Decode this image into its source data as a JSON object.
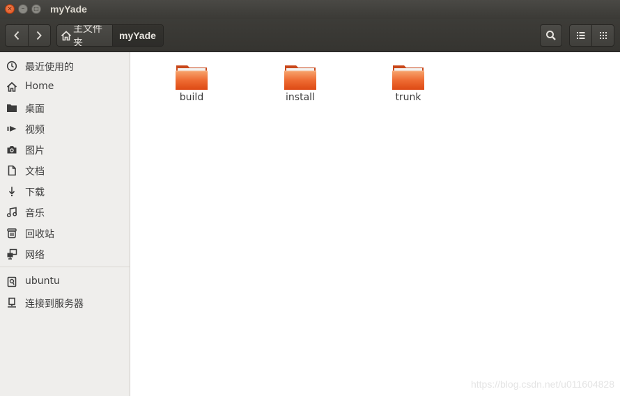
{
  "window": {
    "title": "myYade"
  },
  "window_controls": {
    "close": "×",
    "minimize": "–",
    "maximize": "□"
  },
  "toolbar": {
    "back": "‹",
    "forward": "›",
    "breadcrumbs": [
      "主文件夹",
      "myYade"
    ]
  },
  "sidebar": {
    "items": [
      {
        "label": "最近使用的",
        "icon": "clock-icon"
      },
      {
        "label": "Home",
        "icon": "home-icon"
      },
      {
        "label": "桌面",
        "icon": "folder-icon"
      },
      {
        "label": "视频",
        "icon": "video-icon"
      },
      {
        "label": "图片",
        "icon": "camera-icon"
      },
      {
        "label": "文档",
        "icon": "document-icon"
      },
      {
        "label": "下载",
        "icon": "download-icon"
      },
      {
        "label": "音乐",
        "icon": "music-icon"
      },
      {
        "label": "回收站",
        "icon": "trash-icon"
      },
      {
        "label": "网络",
        "icon": "network-icon"
      }
    ],
    "devices": [
      {
        "label": "ubuntu",
        "icon": "drive-icon"
      },
      {
        "label": "连接到服务器",
        "icon": "server-icon"
      }
    ]
  },
  "files": [
    {
      "name": "build",
      "icon": "folder-icon"
    },
    {
      "name": "install",
      "icon": "folder-icon"
    },
    {
      "name": "trunk",
      "icon": "folder-icon"
    }
  ],
  "watermark": "https://blog.csdn.net/u011604828",
  "colors": {
    "accent": "#e9541d",
    "titlebar": "#3c3b37",
    "sidebar": "#efeeec"
  }
}
